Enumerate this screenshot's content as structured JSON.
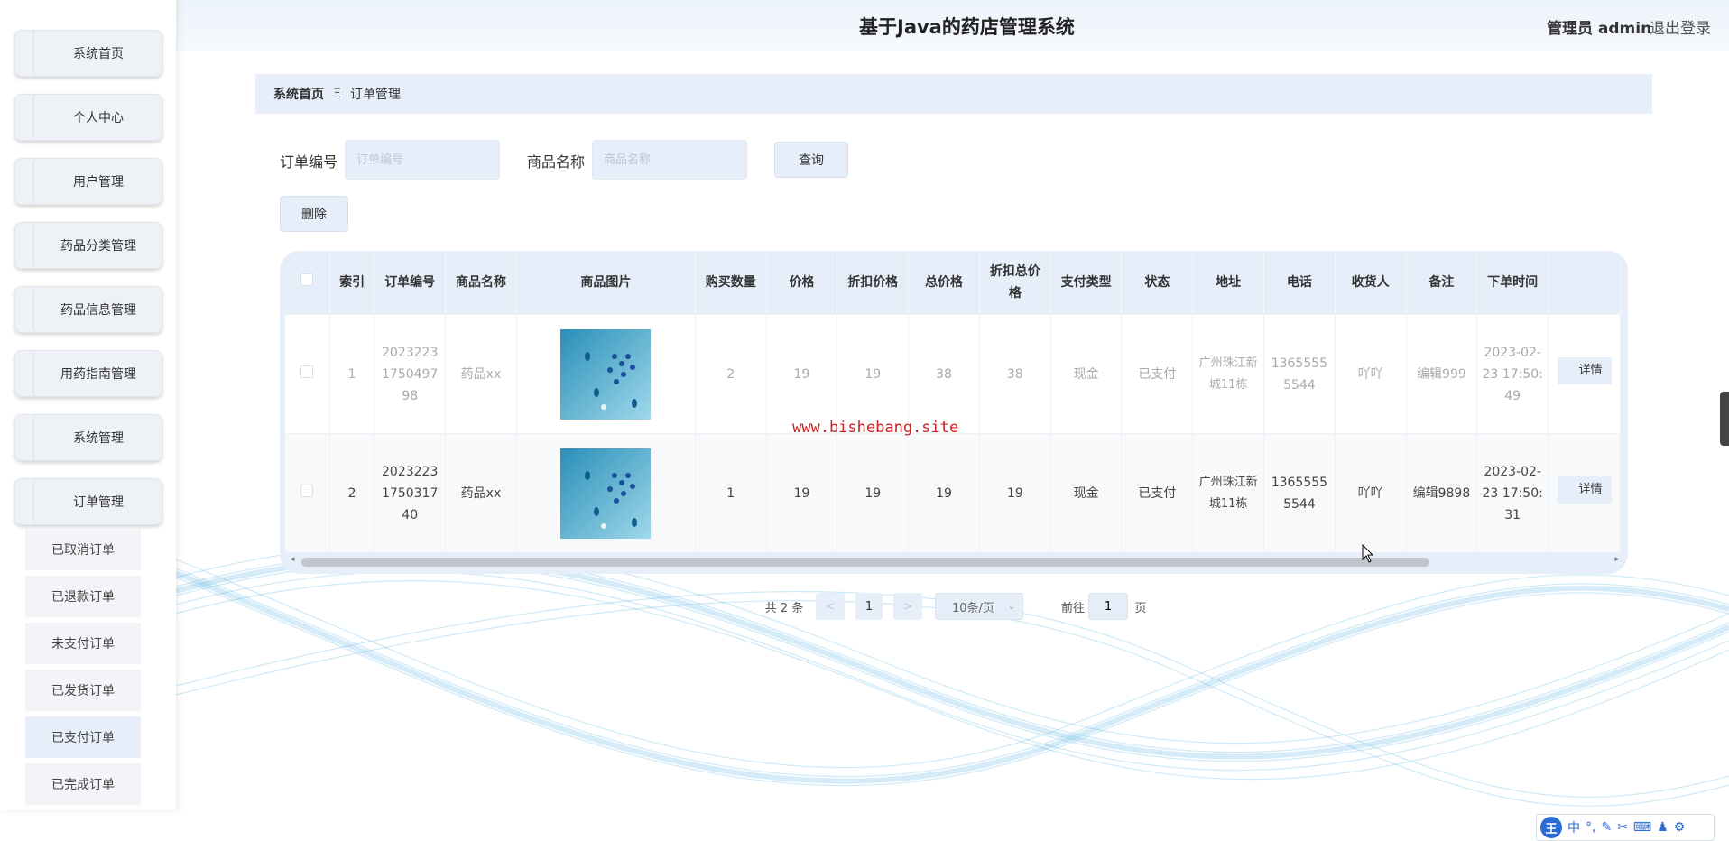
{
  "app": {
    "title": "基于Java的药店管理系统",
    "user_label": "管理员 admin",
    "logout_label": "退出登录"
  },
  "sidebar": {
    "items": [
      {
        "label": "系统首页"
      },
      {
        "label": "个人中心"
      },
      {
        "label": "用户管理"
      },
      {
        "label": "药品分类管理"
      },
      {
        "label": "药品信息管理"
      },
      {
        "label": "用药指南管理"
      },
      {
        "label": "系统管理"
      },
      {
        "label": "订单管理"
      }
    ],
    "submenu": [
      {
        "label": "已取消订单",
        "active": false
      },
      {
        "label": "已退款订单",
        "active": false
      },
      {
        "label": "未支付订单",
        "active": false
      },
      {
        "label": "已发货订单",
        "active": false
      },
      {
        "label": "已支付订单",
        "active": true
      },
      {
        "label": "已完成订单",
        "active": false
      }
    ]
  },
  "breadcrumb": {
    "home": "系统首页",
    "separator": "Ξ",
    "current": "订单管理"
  },
  "search": {
    "order_no_label": "订单编号",
    "order_no_placeholder": "订单编号",
    "order_no_value": "",
    "product_label": "商品名称",
    "product_placeholder": "商品名称",
    "product_value": "",
    "query_button": "查询",
    "delete_button": "删除"
  },
  "table": {
    "columns": [
      "",
      "索引",
      "订单编号",
      "商品名称",
      "商品图片",
      "购买数量",
      "价格",
      "折扣价格",
      "总价格",
      "折扣总价格",
      "支付类型",
      "状态",
      "地址",
      "电话",
      "收货人",
      "备注",
      "下单时间",
      ""
    ],
    "rows": [
      {
        "index": "1",
        "order_no": "20232231750497 98",
        "product": "药品xx",
        "qty": "2",
        "price": "19",
        "discount_price": "19",
        "total": "38",
        "discount_total": "38",
        "pay_type": "现金",
        "status": "已支付",
        "address": "广州珠江新城11栋",
        "phone": "13655555544",
        "receiver": "吖吖",
        "remark": "编辑999",
        "time": "2023-02-23 17:50:49",
        "detail_label": "详情"
      },
      {
        "index": "2",
        "order_no": "20232231750317 40",
        "product": "药品xx",
        "qty": "1",
        "price": "19",
        "discount_price": "19",
        "total": "19",
        "discount_total": "19",
        "pay_type": "现金",
        "status": "已支付",
        "address": "广州珠江新城11栋",
        "phone": "13655555544",
        "receiver": "吖吖",
        "remark": "编辑9898",
        "time": "2023-02-23 17:50:31",
        "detail_label": "详情"
      }
    ]
  },
  "watermark": "www.bishebang.site",
  "pagination": {
    "total": "共 2 条",
    "prev": "<",
    "current_page": "1",
    "next": ">",
    "page_size": "10条/页",
    "goto_label": "前往",
    "goto_value": "1",
    "page_suffix": "页"
  },
  "ime": {
    "logo": "王",
    "mode": "中",
    "icons": [
      "punctuation-icon",
      "pen-icon",
      "scissors-icon",
      "keyboard-icon",
      "shirt-icon",
      "gear-icon"
    ]
  }
}
